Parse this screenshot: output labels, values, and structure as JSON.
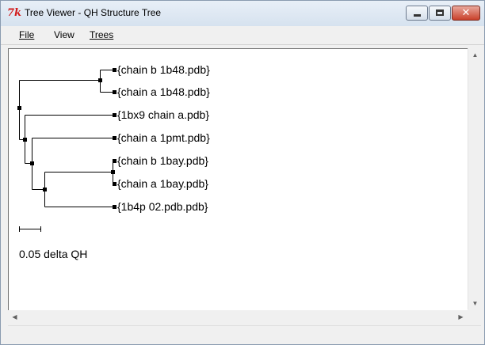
{
  "window": {
    "title": "Tree Viewer - QH Structure Tree",
    "app_icon": "tk-feather-icon",
    "controls": {
      "minimize": "minimize-icon",
      "maximize": "maximize-icon",
      "close": "close-icon",
      "close_glyph": "✕"
    }
  },
  "menu": {
    "file": "File",
    "view": "View",
    "trees": "Trees"
  },
  "tree": {
    "leaves": [
      "{chain b 1b48.pdb}",
      "{chain a 1b48.pdb}",
      "{1bx9 chain a.pdb}",
      "{chain a 1pmt.pdb}",
      "{chain b 1bay.pdb}",
      "{chain a 1bay.pdb}",
      "{1b4p 02.pdb.pdb}"
    ],
    "scale_label": "0.05 delta QH"
  },
  "colors": {
    "close_button": "#c9402a",
    "line": "#000000"
  }
}
